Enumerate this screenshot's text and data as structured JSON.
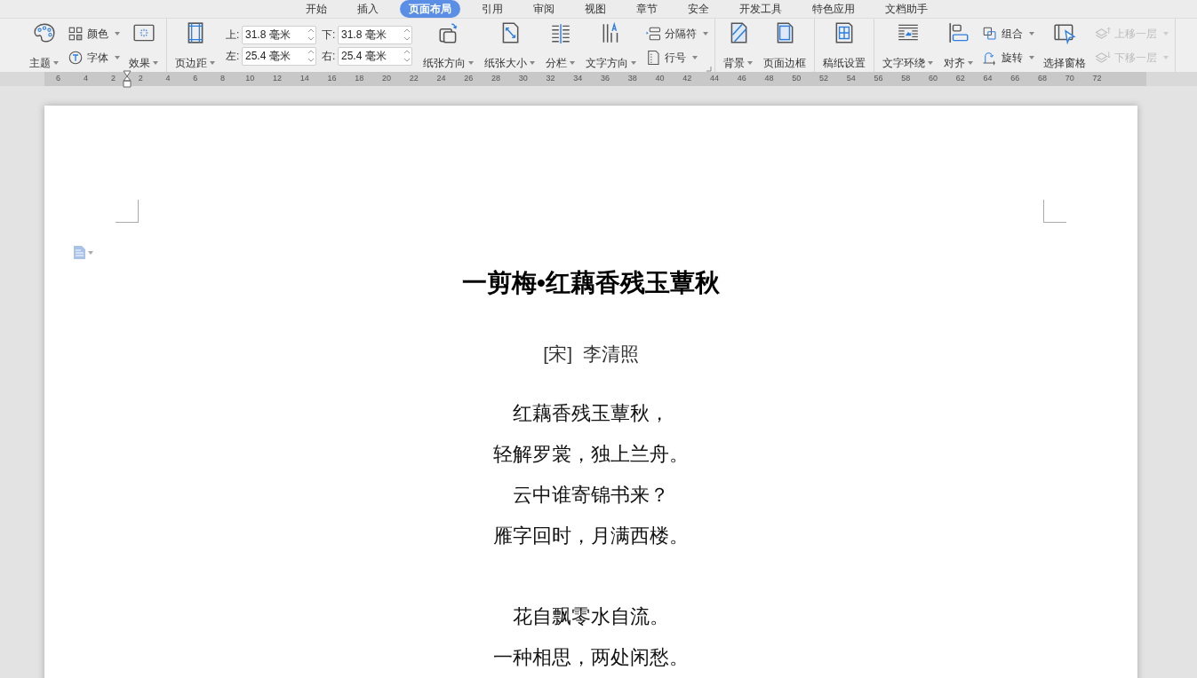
{
  "tabs": [
    {
      "label": "开始",
      "selected": false
    },
    {
      "label": "插入",
      "selected": false
    },
    {
      "label": "页面布局",
      "selected": true
    },
    {
      "label": "引用",
      "selected": false
    },
    {
      "label": "审阅",
      "selected": false
    },
    {
      "label": "视图",
      "selected": false
    },
    {
      "label": "章节",
      "selected": false
    },
    {
      "label": "安全",
      "selected": false
    },
    {
      "label": "开发工具",
      "selected": false
    },
    {
      "label": "特色应用",
      "selected": false
    },
    {
      "label": "文档助手",
      "selected": false
    }
  ],
  "ribbon": {
    "groups": [
      {
        "items": [
          {
            "kind": "large",
            "label": "主题",
            "dropdown": true
          },
          {
            "kind": "stack",
            "items": [
              {
                "label": "颜色",
                "dropdown": true,
                "disabled": false
              },
              {
                "label": "字体",
                "dropdown": true,
                "disabled": false
              }
            ]
          },
          {
            "kind": "large",
            "label": "效果",
            "dropdown": true
          }
        ]
      },
      {
        "launcher": true,
        "items": [
          {
            "kind": "large",
            "label": "页边距",
            "dropdown": true
          },
          {
            "kind": "fields",
            "fields": [
              {
                "label": "上:",
                "value": "31.8 毫米"
              },
              {
                "label": "下:",
                "value": "31.8 毫米"
              },
              {
                "label": "左:",
                "value": "25.4 毫米"
              },
              {
                "label": "右:",
                "value": "25.4 毫米"
              }
            ]
          },
          {
            "kind": "large",
            "label": "纸张方向",
            "dropdown": true
          },
          {
            "kind": "large",
            "label": "纸张大小",
            "dropdown": true
          },
          {
            "kind": "large",
            "label": "分栏",
            "dropdown": true
          },
          {
            "kind": "large",
            "label": "文字方向",
            "dropdown": true
          },
          {
            "kind": "stack",
            "items": [
              {
                "label": "分隔符",
                "dropdown": true,
                "disabled": false
              },
              {
                "label": "行号",
                "dropdown": true,
                "disabled": false
              }
            ]
          }
        ]
      },
      {
        "items": [
          {
            "kind": "large",
            "label": "背景",
            "dropdown": true
          },
          {
            "kind": "large",
            "label": "页面边框",
            "dropdown": false
          }
        ]
      },
      {
        "items": [
          {
            "kind": "large",
            "label": "稿纸设置",
            "dropdown": false
          }
        ]
      },
      {
        "items": [
          {
            "kind": "large",
            "label": "文字环绕",
            "dropdown": true
          },
          {
            "kind": "large",
            "label": "对齐",
            "dropdown": true
          },
          {
            "kind": "stack",
            "items": [
              {
                "label": "组合",
                "dropdown": true,
                "disabled": false
              },
              {
                "label": "旋转",
                "dropdown": true,
                "disabled": false
              }
            ]
          },
          {
            "kind": "large",
            "label": "选择窗格",
            "dropdown": false
          },
          {
            "kind": "stack",
            "items": [
              {
                "label": "上移一层",
                "dropdown": true,
                "disabled": true
              },
              {
                "label": "下移一层",
                "dropdown": true,
                "disabled": true
              }
            ]
          }
        ]
      }
    ]
  },
  "ruler": {
    "left_labels": [
      "6",
      "4",
      "2"
    ],
    "right_labels": [
      "2",
      "4",
      "6",
      "8",
      "10",
      "12",
      "14",
      "16",
      "18",
      "20",
      "22",
      "24",
      "26",
      "28",
      "30",
      "32",
      "34",
      "36",
      "38",
      "40",
      "42",
      "44",
      "46",
      "48",
      "50",
      "52",
      "54",
      "56",
      "58",
      "60",
      "62",
      "64",
      "66",
      "68",
      "70",
      "72"
    ]
  },
  "document": {
    "title": "一剪梅•红藕香残玉蕈秋",
    "author": "[宋]  李清照",
    "stanzas": [
      {
        "lines": [
          "红藕香残玉蕈秋，",
          "轻解罗裳，独上兰舟。",
          "云中谁寄锦书来？",
          "雁字回时，月满西楼。"
        ]
      },
      {
        "lines": [
          "花自飘零水自流。",
          "一种相思，两处闲愁。"
        ]
      }
    ]
  }
}
